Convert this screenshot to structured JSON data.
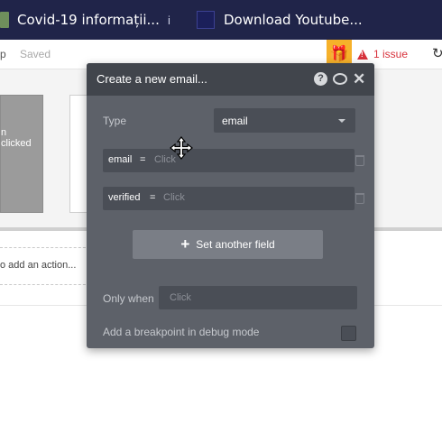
{
  "browser": {
    "tabs": [
      {
        "label": "Covid-19 informații...",
        "icon": "covid-favicon"
      },
      {
        "label": "Download Youtube...",
        "icon": "youtube-favicon"
      }
    ],
    "separator": "i"
  },
  "toolbar": {
    "partial_label": "p",
    "saved_label": "Saved",
    "issue_label": "1 issue"
  },
  "background": {
    "card_text_line1": "n",
    "card_text_line2": "clicked",
    "add_action_text": "o add an action..."
  },
  "modal": {
    "title": "Create a new email...",
    "type_label": "Type",
    "type_value": "email",
    "fields": [
      {
        "name": "email",
        "equals": "=",
        "placeholder": "Click"
      },
      {
        "name": "verified",
        "equals": "=",
        "placeholder": "Click"
      }
    ],
    "set_another_label": "Set another field",
    "only_when_label": "Only when",
    "only_when_placeholder": "Click",
    "breakpoint_label": "Add a breakpoint in debug mode",
    "breakpoint_checked": false
  },
  "colors": {
    "tabbar_bg": "#202449",
    "modal_bg": "#5d6169",
    "modal_header_bg": "#41454c",
    "issue_red": "#d8323c",
    "gift_orange": "#f6b12a"
  }
}
